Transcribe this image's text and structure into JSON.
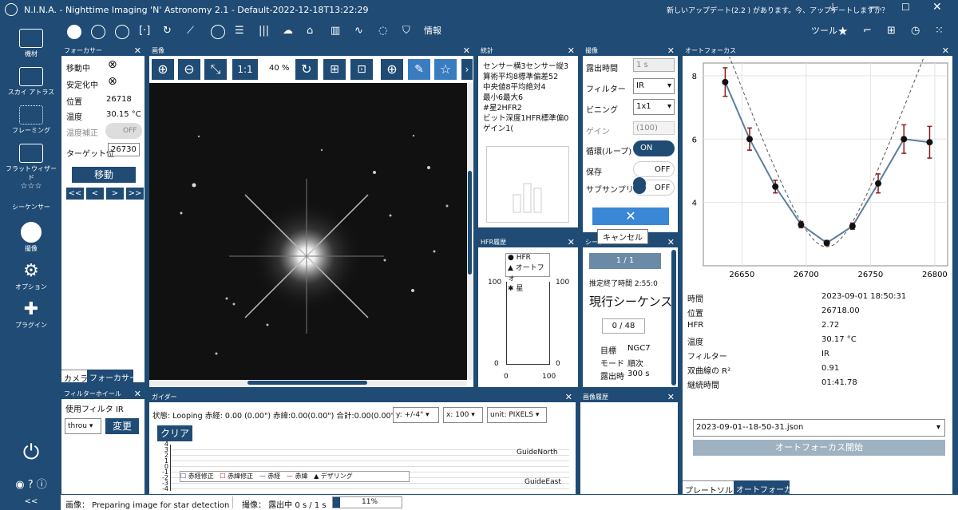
{
  "app": {
    "title": "N.I.N.A. - Nighttime Imaging 'N' Astronomy 2.1  -  Default-2022-12-18T13:22:29",
    "update_text": "新しいアップデート(2.2 ) があります。今、アップデートしますか？"
  },
  "toolbar": {
    "info_label": "情報",
    "tools_label": "ツール"
  },
  "sidebar": {
    "items": [
      "機材",
      "スカイ アトラス",
      "フレーミング",
      "フラットウィザード",
      "シーケンサー",
      "撮像",
      "オプション",
      "プラグイン"
    ],
    "collapse": "<<"
  },
  "focuser": {
    "header": "フォーカサー",
    "moving_label": "移動中",
    "settled_label": "安定化中",
    "position_label": "位置",
    "position_value": "26718",
    "temp_label": "温度",
    "temp_value": "30.15 °C",
    "tempcomp_label": "温度補正",
    "tempcomp_value": "OFF",
    "target_label": "ターゲット位",
    "target_value": "26730",
    "move_button": "移動",
    "nav": [
      "<<",
      "<",
      ">",
      ">>"
    ],
    "tabs": [
      "カメラ",
      "フォーカサー"
    ]
  },
  "filterwheel": {
    "header": "フィルターホイール",
    "label": "使用フィルタ IR",
    "select": "throu",
    "change_button": "変更"
  },
  "image": {
    "header": "画像",
    "zoom_11": "1:1",
    "zoom_pct": "40 %"
  },
  "stats": {
    "header": "統計",
    "rows": [
      [
        "センサー横",
        "3センサー縦",
        "3"
      ],
      [
        "算術平均",
        "8標準偏差",
        "52"
      ],
      [
        "中央値",
        "8平均絶対",
        "4"
      ],
      [
        "最小",
        "6最大",
        "6"
      ],
      [
        "#星",
        "2HFR",
        "2"
      ],
      [
        "ビット深度",
        "1HFR標準偏",
        "0"
      ],
      [
        "ゲイン",
        "1(",
        ""
      ]
    ]
  },
  "imaging": {
    "header": "撮像",
    "exposure_label": "露出時間",
    "exposure_value": "1 s",
    "filter_label": "フィルター",
    "filter_value": "IR",
    "binning_label": "ビニング",
    "binning_value": "1x1",
    "gain_label": "ゲイン",
    "gain_value": "(100)",
    "loop_label": "循環(ループ)",
    "loop_value": "ON",
    "save_label": "保存",
    "save_value": "OFF",
    "subsample_label": "サブサンプリン",
    "subsample_value": "OFF",
    "cancel_tooltip": "キャンセル"
  },
  "hfr": {
    "header": "HFR履歴",
    "legend": [
      "HFR",
      "オートフォ",
      "星"
    ],
    "y_left": [
      "100",
      "0"
    ],
    "y_right": [
      "100",
      "0"
    ],
    "x": [
      "0",
      "100"
    ]
  },
  "sequence": {
    "header": "シーケ",
    "progress": "1 / 1",
    "eta": "推定終了時間 2:55:0",
    "current": "現行シーケンス",
    "count": "0 / 48",
    "target_label": "目標",
    "target_value": "NGC7",
    "mode_label": "モード",
    "mode_value": "順次",
    "exp_label": "露出時",
    "exp_value": "300 s"
  },
  "guider": {
    "header": "ガイダー",
    "status": "状態: Looping  赤経: 0.00 (0.00\")  赤緯:0.00(0.00\")  合計:0.00(0.00\")",
    "y_select": "y: +/-4\"",
    "x_select": "x: 100",
    "unit_select": "unit: PIXELS",
    "clear_button": "クリア",
    "ticks": [
      "4",
      "3",
      "2",
      "1",
      "0",
      "-1",
      "-2",
      "-3",
      "-4"
    ],
    "north": "GuideNorth",
    "east": "GuideEast",
    "legend": [
      "赤経修正",
      "赤緯修正",
      "赤経",
      "赤緯",
      "デザリング"
    ]
  },
  "imghistory": {
    "header": "画像履歴"
  },
  "autofocus": {
    "header": "オートフォーカス",
    "rows": [
      [
        "時間",
        "2023-09-01 18:50:31"
      ],
      [
        "位置",
        "26718.00"
      ],
      [
        "HFR",
        "2.72"
      ],
      [
        "温度",
        "30.17 °C"
      ],
      [
        "フィルター",
        "IR"
      ],
      [
        "双曲線の R²",
        "0.91"
      ],
      [
        "継続時間",
        "01:41.78"
      ]
    ],
    "file": "2023-09-01--18-50-31.json",
    "start_button": "オートフォーカス開始",
    "tabs": [
      "プレートソルブ",
      "オートフォーカス"
    ]
  },
  "status": {
    "image": "画像：  Preparing image for star detection",
    "capture": "撮像：  露出中 0 s / 1 s",
    "percent": "11%",
    "progress": 0.11
  },
  "chart_data": {
    "type": "scatter",
    "x": [
      26637,
      26656,
      26676,
      26696,
      26716,
      26736,
      26756,
      26776,
      26796
    ],
    "y": [
      7.8,
      6.0,
      4.5,
      3.3,
      2.72,
      3.25,
      4.6,
      6.0,
      5.9
    ],
    "err": [
      0.45,
      0.35,
      0.2,
      0.1,
      0.08,
      0.1,
      0.3,
      0.45,
      0.5
    ],
    "xlim": [
      26620,
      26810
    ],
    "ylim": [
      2.0,
      8.4
    ],
    "xticks": [
      26650,
      26700,
      26750,
      26800
    ],
    "yticks": [
      4,
      6,
      8
    ],
    "colors": {
      "points": "#111111",
      "error": "#8b1a1a",
      "line": "#5a7fa0",
      "fit": "#555555"
    }
  }
}
